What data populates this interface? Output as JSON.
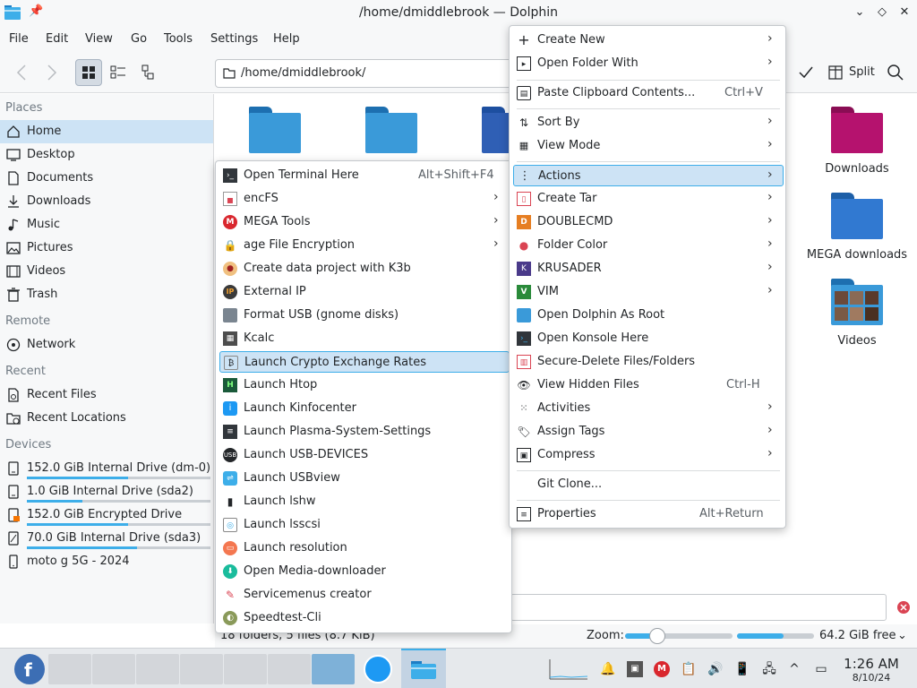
{
  "window": {
    "title": "/home/dmiddlebrook — Dolphin",
    "controls": {
      "minimize": "⌄",
      "maximize": "◇",
      "close": "✕"
    }
  },
  "menubar": [
    "File",
    "Edit",
    "View",
    "Go",
    "Tools",
    "Settings",
    "Help"
  ],
  "toolbar": {
    "path": "/home/dmiddlebrook/",
    "split_label": "Split"
  },
  "sidebar": {
    "places_title": "Places",
    "places": [
      {
        "label": "Home",
        "icon": "home-icon"
      },
      {
        "label": "Desktop",
        "icon": "desktop-icon"
      },
      {
        "label": "Documents",
        "icon": "documents-icon"
      },
      {
        "label": "Downloads",
        "icon": "downloads-icon"
      },
      {
        "label": "Music",
        "icon": "music-icon"
      },
      {
        "label": "Pictures",
        "icon": "pictures-icon"
      },
      {
        "label": "Videos",
        "icon": "videos-icon"
      },
      {
        "label": "Trash",
        "icon": "trash-icon"
      }
    ],
    "remote_title": "Remote",
    "remote": [
      {
        "label": "Network",
        "icon": "network-icon"
      }
    ],
    "recent_title": "Recent",
    "recent": [
      {
        "label": "Recent Files",
        "icon": "recent-files-icon"
      },
      {
        "label": "Recent Locations",
        "icon": "recent-locations-icon"
      }
    ],
    "devices_title": "Devices",
    "devices": [
      {
        "label": "152.0 GiB Internal Drive (dm-0)",
        "usage": 0.55
      },
      {
        "label": "1.0 GiB Internal Drive (sda2)",
        "usage": 0.3
      },
      {
        "label": "152.0 GiB Encrypted Drive",
        "usage": 0.55
      },
      {
        "label": "70.0 GiB Internal Drive (sda3)",
        "usage": 0.6
      },
      {
        "label": "moto g 5G - 2024",
        "usage": null
      }
    ]
  },
  "content": {
    "files_right": [
      "Downloads",
      "MEGA downloads",
      "Videos"
    ]
  },
  "actions_menu": {
    "items": [
      {
        "label": "Open Terminal Here",
        "shortcut": "Alt+Shift+F4"
      },
      {
        "label": "encFS",
        "submenu": true
      },
      {
        "label": "MEGA Tools",
        "submenu": true
      },
      {
        "label": "age File Encryption",
        "submenu": true
      },
      {
        "label": "Create data project with K3b"
      },
      {
        "label": "External IP"
      },
      {
        "label": "Format USB (gnome disks)"
      },
      {
        "label": "Kcalc"
      },
      {
        "label": "Launch Crypto Exchange Rates",
        "highlighted": true
      },
      {
        "label": "Launch Htop"
      },
      {
        "label": "Launch Kinfocenter"
      },
      {
        "label": "Launch Plasma-System-Settings"
      },
      {
        "label": "Launch USB-DEVICES"
      },
      {
        "label": "Launch USBview"
      },
      {
        "label": "Launch lshw"
      },
      {
        "label": "Launch lsscsi"
      },
      {
        "label": "Launch resolution"
      },
      {
        "label": "Open Media-downloader"
      },
      {
        "label": "Servicemenus creator"
      },
      {
        "label": "Speedtest-Cli"
      }
    ]
  },
  "context_menu": {
    "items": [
      {
        "label": "Create New",
        "submenu": true
      },
      {
        "label": "Open Folder With",
        "submenu": true
      },
      {
        "label": "Paste Clipboard Contents...",
        "shortcut": "Ctrl+V"
      },
      {
        "label": "Sort By",
        "submenu": true
      },
      {
        "label": "View Mode",
        "submenu": true
      },
      {
        "label": "Actions",
        "submenu": true,
        "highlighted": true
      },
      {
        "label": "Create Tar",
        "submenu": true
      },
      {
        "label": "DOUBLECMD",
        "submenu": true
      },
      {
        "label": "Folder Color",
        "submenu": true
      },
      {
        "label": "KRUSADER",
        "submenu": true
      },
      {
        "label": "VIM",
        "submenu": true
      },
      {
        "label": "Open Dolphin As Root"
      },
      {
        "label": "Open Konsole Here"
      },
      {
        "label": "Secure-Delete Files/Folders"
      },
      {
        "label": "View Hidden Files",
        "shortcut": "Ctrl-H"
      },
      {
        "label": "Activities",
        "submenu": true
      },
      {
        "label": "Assign Tags",
        "submenu": true
      },
      {
        "label": "Compress",
        "submenu": true
      },
      {
        "label": "Git Clone..."
      },
      {
        "label": "Properties",
        "shortcut": "Alt+Return"
      }
    ]
  },
  "statusbar": {
    "summary": "18 folders, 5 files (8.7 KiB)",
    "zoom_label": "Zoom:",
    "zoom_level": 0.3,
    "free_space": "64.2 GiB free",
    "free_fraction": 0.6
  },
  "taskbar": {
    "time": "1:26 AM",
    "date": "8/10/24"
  },
  "colors": {
    "accent": "#3daee9",
    "selection": "#cde3f5",
    "folder_blue": "#3a9ad9",
    "folder_magenta": "#b5126e"
  }
}
